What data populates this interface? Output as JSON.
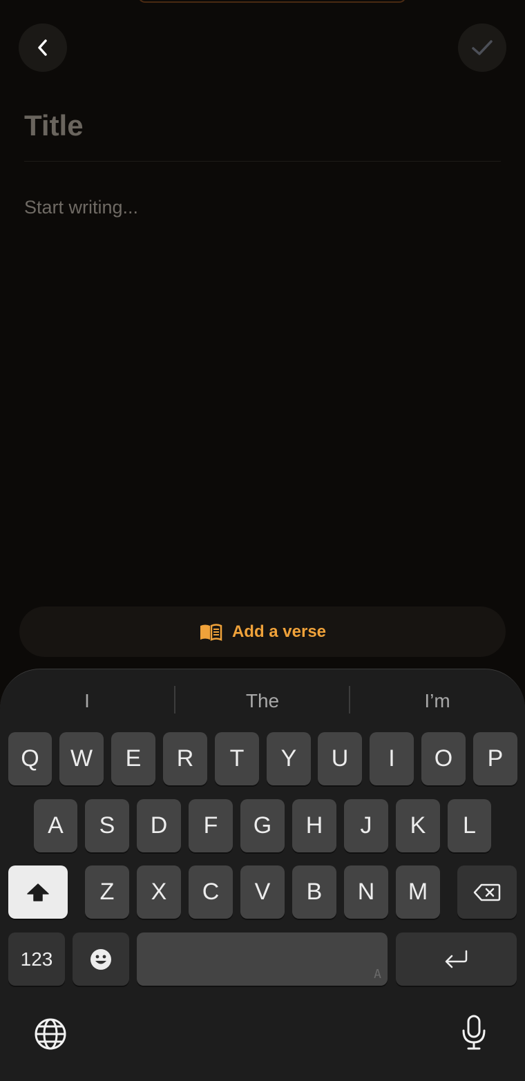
{
  "header": {
    "back_icon": "chevron-left-icon",
    "done_icon": "checkmark-icon"
  },
  "editor": {
    "title_placeholder": "Title",
    "body_placeholder": "Start writing..."
  },
  "verse_button": {
    "icon": "book-icon",
    "label": "Add a verse",
    "accent_color": "#f0a23a"
  },
  "keyboard": {
    "suggestions": [
      "I",
      "The",
      "I’m"
    ],
    "row1": [
      "Q",
      "W",
      "E",
      "R",
      "T",
      "Y",
      "U",
      "I",
      "O",
      "P"
    ],
    "row2": [
      "A",
      "S",
      "D",
      "F",
      "G",
      "H",
      "J",
      "K",
      "L"
    ],
    "row3": [
      "Z",
      "X",
      "C",
      "V",
      "B",
      "N",
      "M"
    ],
    "numbers_label": "123",
    "space_hint": "A",
    "shift_icon": "shift-icon",
    "backspace_icon": "backspace-icon",
    "emoji_icon": "emoji-icon",
    "return_icon": "return-icon",
    "globe_icon": "globe-icon",
    "mic_icon": "microphone-icon"
  }
}
